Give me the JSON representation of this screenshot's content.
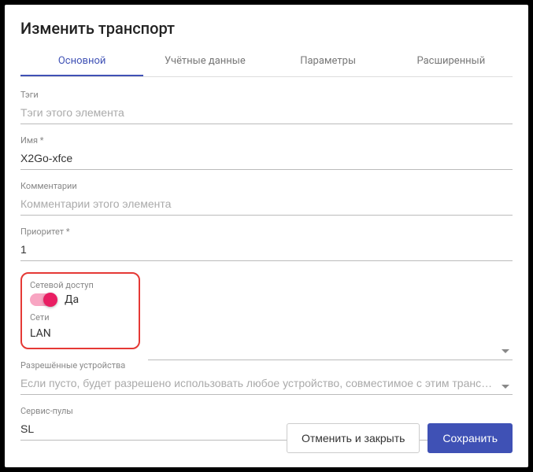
{
  "dialog": {
    "title": "Изменить транспорт"
  },
  "tabs": [
    {
      "label": "Основной",
      "active": true
    },
    {
      "label": "Учётные данные",
      "active": false
    },
    {
      "label": "Параметры",
      "active": false
    },
    {
      "label": "Расширенный",
      "active": false
    }
  ],
  "fields": {
    "tags": {
      "label": "Тэги",
      "placeholder": "Тэги этого элемента",
      "value": ""
    },
    "name": {
      "label": "Имя *",
      "value": "X2Go-xfce"
    },
    "comments": {
      "label": "Комментарии",
      "placeholder": "Комментарии этого элемента",
      "value": ""
    },
    "priority": {
      "label": "Приоритет *",
      "value": "1"
    },
    "netaccess": {
      "label": "Сетевой доступ",
      "state_label": "Да",
      "on": true
    },
    "networks": {
      "label": "Сети",
      "value": "LAN"
    },
    "devices": {
      "label": "Разрешённые устройства",
      "placeholder": "Если пусто, будет разрешено использовать любое устройство, совместимое с этим трансп…",
      "value": ""
    },
    "pools": {
      "label": "Сервис-пулы",
      "value": "SL"
    }
  },
  "actions": {
    "cancel": "Отменить и закрыть",
    "save": "Сохранить"
  }
}
